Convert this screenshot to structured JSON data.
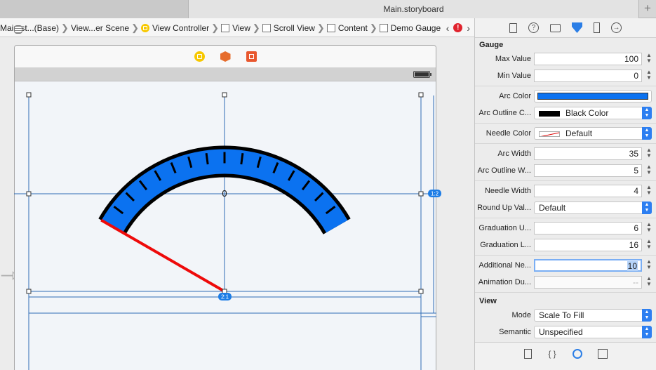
{
  "window": {
    "tab_title": "Main.storyboard",
    "plus": "+"
  },
  "breadcrumbs": [
    {
      "label": "Main.st...(Base)",
      "icon": "storyboard-icon"
    },
    {
      "label": "View...er Scene",
      "icon": "scene-icon"
    },
    {
      "label": "View Controller",
      "icon": "view-controller-icon"
    },
    {
      "label": "View",
      "icon": "view-icon"
    },
    {
      "label": "Scroll View",
      "icon": "view-icon"
    },
    {
      "label": "Content",
      "icon": "view-icon"
    },
    {
      "label": "Demo Gauge",
      "icon": "view-icon"
    }
  ],
  "jump_nav": {
    "back": "‹",
    "error": "!",
    "forward": "›"
  },
  "canvas": {
    "gauge_center_label": "0",
    "constraint_badge_right": "1:2",
    "constraint_badge_bottom": "2:1",
    "arc_color": "#0b72f0",
    "outline_color": "#000000",
    "needle_color": "#ee0a0a",
    "needle_value_fraction": 0.0,
    "graduation_count": 16
  },
  "inspector": {
    "gauge_section": "Gauge",
    "view_section": "View",
    "rows": {
      "max_value": {
        "label": "Max Value",
        "value": "100"
      },
      "min_value": {
        "label": "Min Value",
        "value": "0"
      },
      "arc_color": {
        "label": "Arc Color"
      },
      "arc_outline_color": {
        "label": "Arc Outline C...",
        "value": "Black Color"
      },
      "needle_color": {
        "label": "Needle Color",
        "value": "Default"
      },
      "arc_width": {
        "label": "Arc Width",
        "value": "35"
      },
      "arc_outline_width": {
        "label": "Arc Outline W...",
        "value": "5"
      },
      "needle_width": {
        "label": "Needle Width",
        "value": "4"
      },
      "round_up_value": {
        "label": "Round Up Val...",
        "value": "Default"
      },
      "graduation_units": {
        "label": "Graduation U...",
        "value": "6"
      },
      "graduation_length": {
        "label": "Graduation L...",
        "value": "16"
      },
      "additional_needle": {
        "label": "Additional Ne...",
        "value": "10"
      },
      "animation_duration": {
        "label": "Animation Du...",
        "value": "--"
      },
      "mode": {
        "label": "Mode",
        "value": "Scale To Fill"
      },
      "semantic": {
        "label": "Semantic",
        "value": "Unspecified"
      }
    },
    "bottom_icons": [
      "file-template-icon",
      "code-snippet-icon",
      "object-library-icon",
      "media-library-icon"
    ]
  }
}
